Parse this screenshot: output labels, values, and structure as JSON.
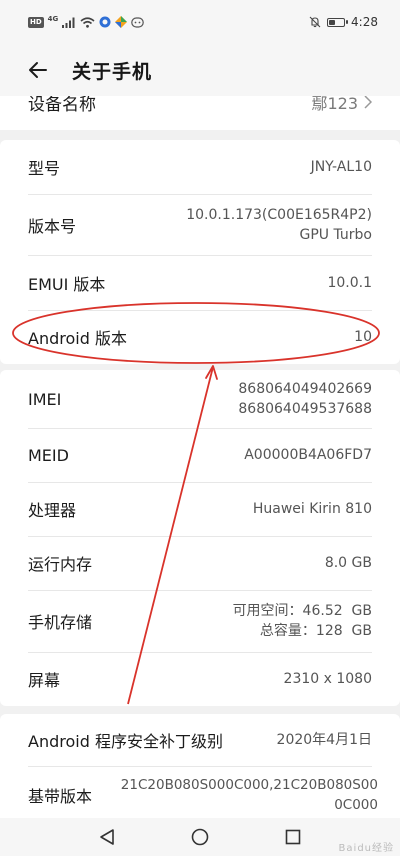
{
  "status_bar": {
    "network_badge": "HD",
    "network_type": "4G",
    "time": "4:28",
    "battery_level": 0.45
  },
  "header": {
    "title": "关于手机"
  },
  "device": {
    "label": "设备名称",
    "value": "鄢123"
  },
  "card1": {
    "rows": [
      {
        "label": "型号",
        "lines": [
          "JNY-AL10"
        ]
      },
      {
        "label": "版本号",
        "lines": [
          "10.0.1.173(C00E165R4P2)",
          "GPU Turbo"
        ]
      },
      {
        "label": "EMUI 版本",
        "lines": [
          "10.0.1"
        ]
      },
      {
        "label": "Android 版本",
        "lines": [
          "10"
        ]
      }
    ]
  },
  "card2": {
    "rows": [
      {
        "label": "IMEI",
        "lines": [
          "868064049402669",
          "868064049537688"
        ]
      },
      {
        "label": "MEID",
        "lines": [
          "A00000B4A06FD7"
        ]
      },
      {
        "label": "处理器",
        "lines": [
          "Huawei Kirin 810"
        ]
      },
      {
        "label": "运行内存",
        "lines": [
          "8.0 GB"
        ]
      },
      {
        "label": "手机存储",
        "lines": [
          "可用空间：46.52  GB",
          "总容量：128  GB"
        ]
      },
      {
        "label": "屏幕",
        "lines": [
          "2310 x 1080"
        ]
      }
    ]
  },
  "card3": {
    "rows": [
      {
        "label": "Android 程序安全补丁级别",
        "lines": [
          "2020年4月1日"
        ]
      },
      {
        "label": "基带版本",
        "lines": [
          "21C20B080S000C000,21C20B080S00",
          "0C000"
        ]
      }
    ]
  },
  "watermark": "Baidu经验",
  "colors": {
    "annotation": "#d9332b",
    "background": "#f1f1f1",
    "card": "#ffffff"
  }
}
